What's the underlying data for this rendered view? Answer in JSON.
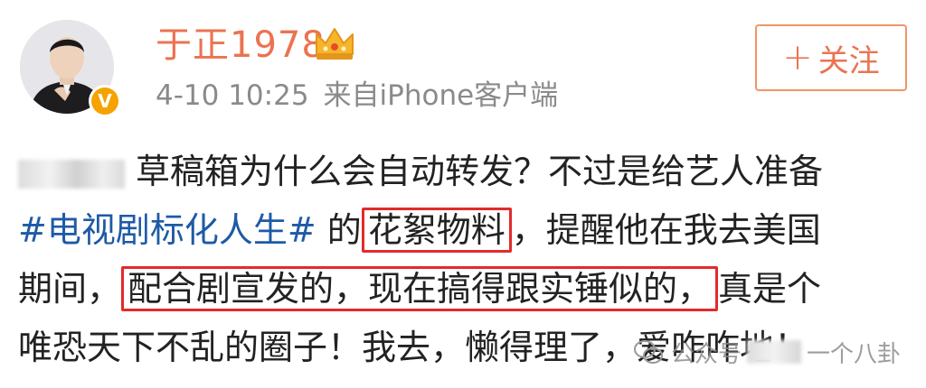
{
  "user": {
    "name": "于正1978",
    "time": "4-10 10:25",
    "source": "来自iPhone客户端",
    "verified_badge": "V"
  },
  "follow_button": {
    "plus": "+",
    "label": "关注"
  },
  "post": {
    "line1_text": "草稿箱为什么会自动转发？不过是给艺人准备",
    "line2_hashtag": "#电视剧标化人生#",
    "line2_mid": " 的",
    "line2_highlight": "花絮物料",
    "line2_end": "，提醒他在我去美国",
    "line3_start": "期间，",
    "line3_highlight": "配合剧宣发的，现在搞得跟实锤似的，",
    "line3_end": "真是个",
    "line4_text": "唯恐天下不乱的圈子！我去，懒得理了，爱咋咋地！"
  },
  "watermark": {
    "prefix": "公众号",
    "suffix": "一个八卦"
  },
  "colors": {
    "username": "#eb7350",
    "hashtag": "#1e5aa6",
    "highlight_box": "#e22b2b",
    "follow_border": "#f29466",
    "meta_text": "#8a8a8a"
  },
  "icons": [
    "avatar",
    "verified-v-icon",
    "crown-icon",
    "wechat-watermark-icon"
  ]
}
